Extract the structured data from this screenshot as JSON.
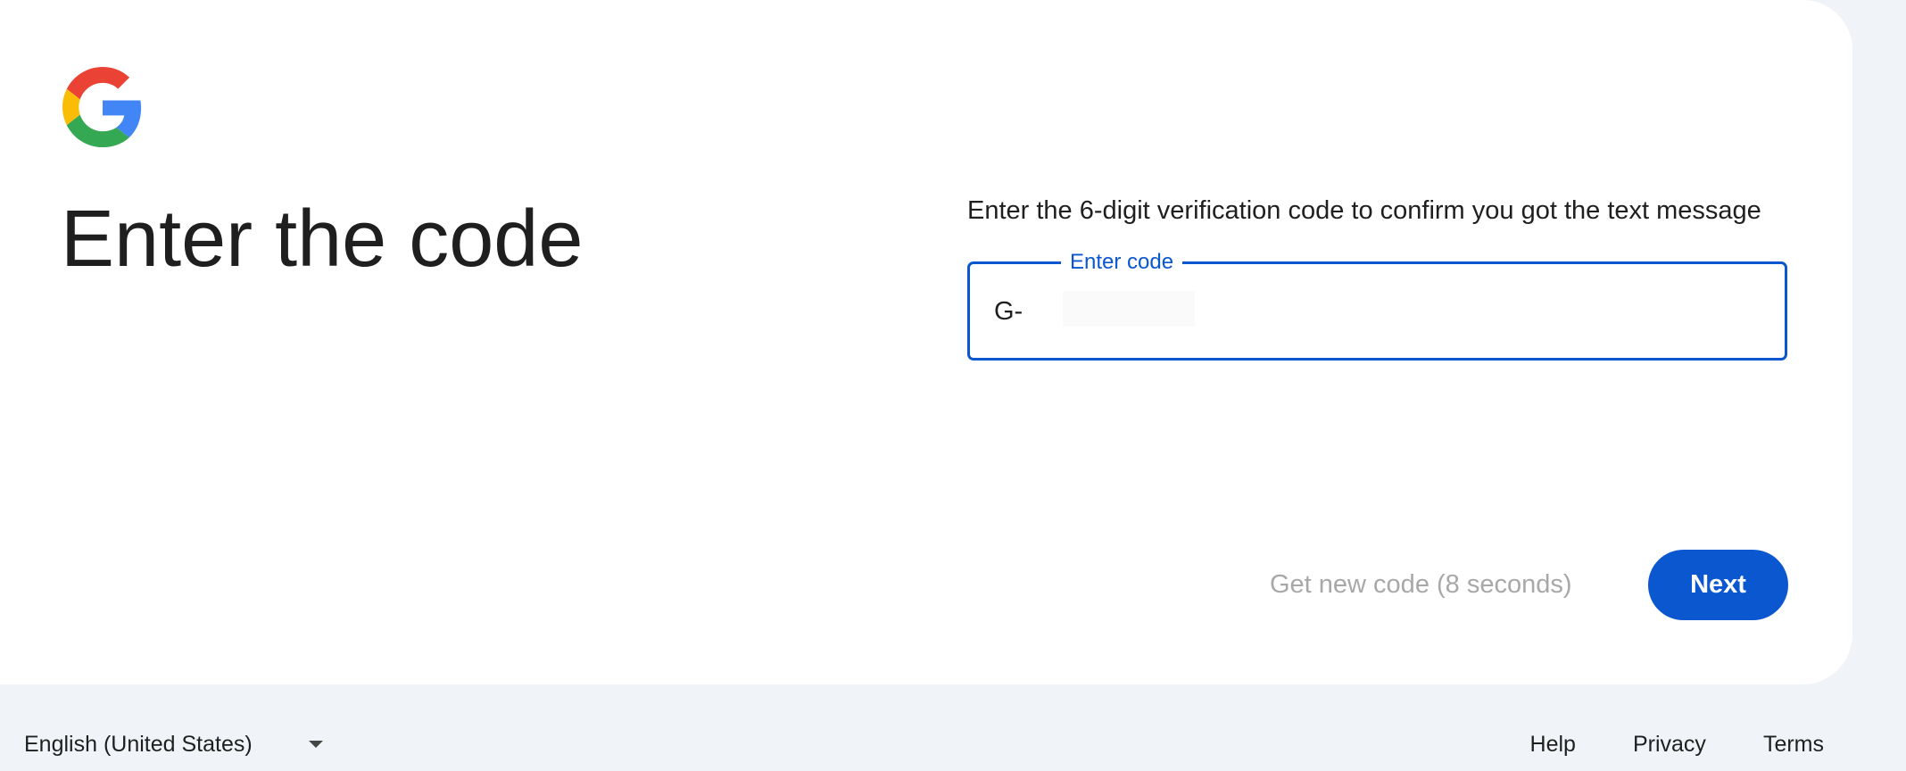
{
  "page": {
    "title": "Enter the code",
    "instructions": "Enter the 6-digit verification code to confirm you got the text message"
  },
  "code_field": {
    "label": "Enter code",
    "prefix": "G-",
    "value": ""
  },
  "actions": {
    "resend_label": "Get new code (8 seconds)",
    "next_label": "Next"
  },
  "footer": {
    "language": "English (United States)",
    "links": [
      "Help",
      "Privacy",
      "Terms"
    ]
  },
  "colors": {
    "accent": "#0b57d0",
    "page_background": "#f0f4f9",
    "disabled_text": "#a8a8a8"
  },
  "icons": {
    "logo": "google-g-logo-icon",
    "language_dropdown": "chevron-down-icon"
  }
}
